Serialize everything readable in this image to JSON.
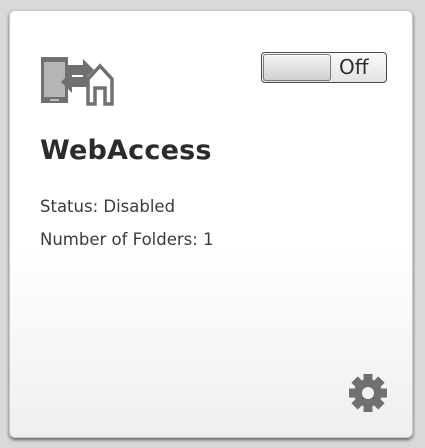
{
  "app": {
    "title": "WebAccess",
    "icon": "webaccess-icon"
  },
  "toggle": {
    "state_label": "Off",
    "enabled": false
  },
  "status": {
    "status_line": "Status: Disabled",
    "folders_line": "Number of Folders: 1"
  },
  "settings": {
    "icon": "gear-icon"
  },
  "colors": {
    "text": "#2b2b2b",
    "icon": "#707070",
    "card_background": "#ffffff",
    "page_background": "#d9d9d9"
  }
}
